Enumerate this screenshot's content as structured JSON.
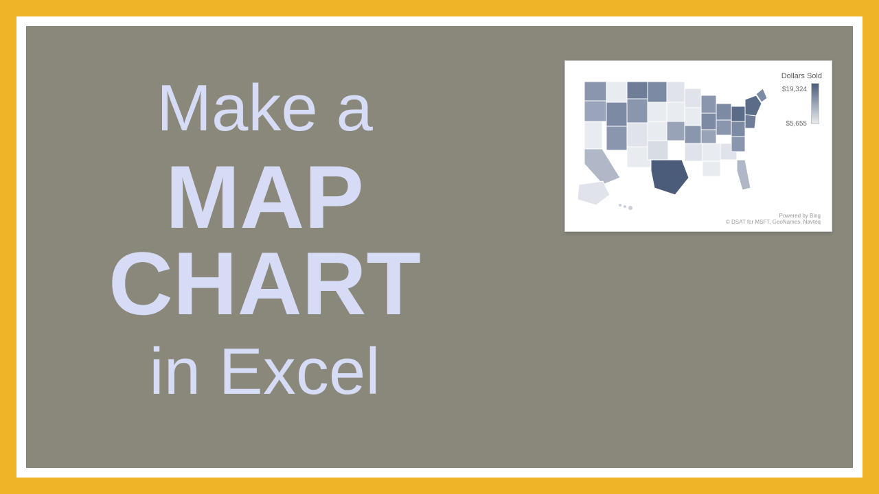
{
  "title": {
    "line1": "Make a",
    "line2": "MAP",
    "line3": "CHART",
    "line4": "in Excel"
  },
  "map_thumbnail": {
    "legend_title": "Dollars Sold",
    "legend_max": "$19,324",
    "legend_min": "$5,655",
    "attribution_line1": "Powered by Bing",
    "attribution_line2": "© DSAT for MSFT, GeoNames, Navteq"
  },
  "colors": {
    "outer_border": "#f0b429",
    "canvas_bg": "#8a877b",
    "title_text": "#d6dcf5",
    "map_dark": "#4a5c7a",
    "map_mid": "#8a96ae",
    "map_light": "#e8ebef"
  }
}
